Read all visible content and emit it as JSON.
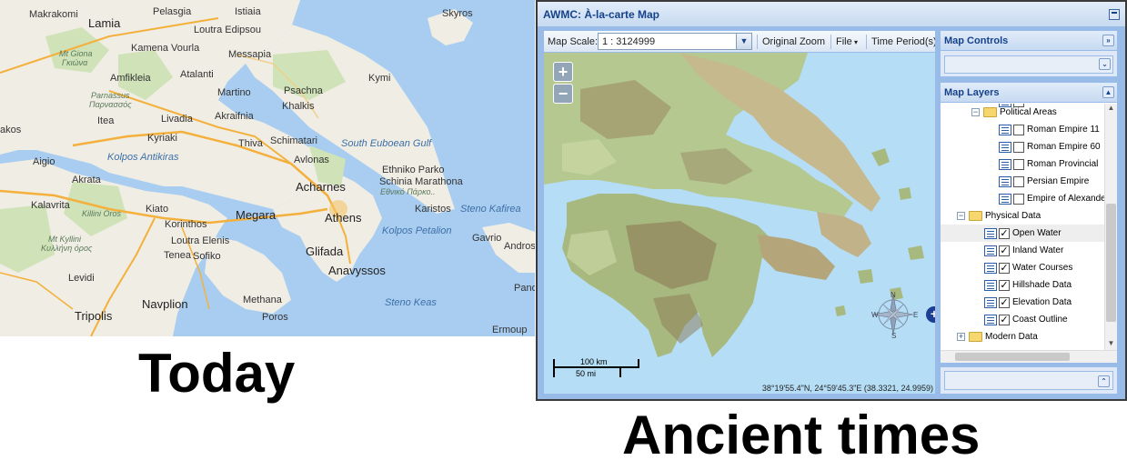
{
  "captions": {
    "today": "Today",
    "ancient": "Ancient times"
  },
  "today_map": {
    "places": [
      "Makrakomi",
      "Lamia",
      "Pelasgia",
      "Istiaia",
      "Skyros",
      "Loutra Edipsou",
      "Kamena Vourla",
      "Mt Giona",
      "Γκιώνα",
      "Messapia",
      "Amfikleia",
      "Atalanti",
      "Kymi",
      "Parnassus",
      "Παρνασσός",
      "Martino",
      "Psachna",
      "Itea",
      "Livadia",
      "Akraifnia",
      "Khalkis",
      "akos",
      "Kyriaki",
      "Thiva",
      "Schimatari",
      "South Euboean Gulf",
      "Aigio",
      "Kolpos Antikiras",
      "Avlonas",
      "Akrata",
      "Ethniko Parko",
      "Schinia Marathona",
      "Εθνικό Πάρκο..",
      "Acharnes",
      "Kalavrita",
      "Killini Oros",
      "Kiato",
      "Megara",
      "Athens",
      "Karistos",
      "Steno Kafirea",
      "Korinthos",
      "Kolpos Petalion",
      "Mt Kyllini",
      "Κυλλήνη όρος",
      "Loutra Elenis",
      "Gavrio",
      "Andros",
      "Tenea",
      "Sofiko",
      "Glifada",
      "Levidi",
      "Anavyssos",
      "Navplion",
      "Methana",
      "Tripolis",
      "Steno Keas",
      "Poros",
      "Pano",
      "Ermoup"
    ]
  },
  "app": {
    "title": "AWMC: À-la-carte Map",
    "toolbar": {
      "scale_label": "Map Scale:",
      "scale_value": "1 : 3124999",
      "original_zoom": "Original Zoom",
      "file": "File",
      "time_periods": "Time Period(s)"
    },
    "map": {
      "zoom_in": "+",
      "zoom_out": "−",
      "scale_km": "100 km",
      "scale_mi": "50 mi",
      "coordinates": "38°19'55.4\"N, 24°59'45.3\"E (38.3321, 24.9959)",
      "compass": {
        "n": "N",
        "w": "W",
        "e": "E",
        "s": "S"
      },
      "expand": "+"
    },
    "map_controls": {
      "title": "Map Controls"
    },
    "map_layers": {
      "title": "Map Layers",
      "tree": [
        {
          "label": "Political Areas",
          "kind": "folder",
          "expanded": true
        },
        {
          "label": "Roman Empire 11",
          "kind": "layer",
          "checked": false
        },
        {
          "label": "Roman Empire 60",
          "kind": "layer",
          "checked": false
        },
        {
          "label": "Roman Provincial",
          "kind": "layer",
          "checked": false
        },
        {
          "label": "Persian Empire",
          "kind": "layer",
          "checked": false
        },
        {
          "label": "Empire of Alexander",
          "kind": "layer",
          "checked": false
        },
        {
          "label": "Physical Data",
          "kind": "folder",
          "expanded": true
        },
        {
          "label": "Open Water",
          "kind": "layer",
          "checked": true,
          "selected": true
        },
        {
          "label": "Inland Water",
          "kind": "layer",
          "checked": true
        },
        {
          "label": "Water Courses",
          "kind": "layer",
          "checked": true
        },
        {
          "label": "Hillshade Data",
          "kind": "layer",
          "checked": true
        },
        {
          "label": "Elevation Data",
          "kind": "layer",
          "checked": true
        },
        {
          "label": "Coast Outline",
          "kind": "layer",
          "checked": true
        },
        {
          "label": "Modern Data",
          "kind": "folder",
          "expanded": false
        }
      ]
    }
  }
}
